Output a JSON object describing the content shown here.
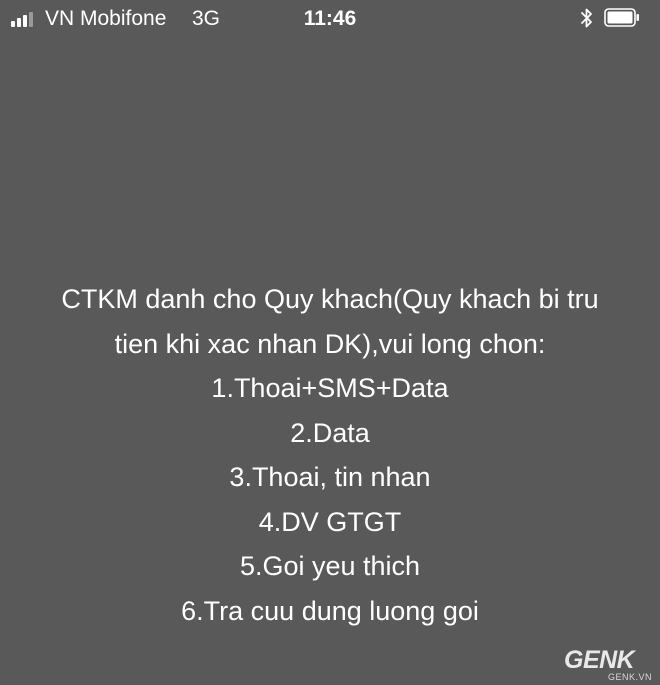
{
  "status_bar": {
    "carrier": "VN Mobifone",
    "network": "3G",
    "time": "11:46",
    "signal_bars_filled": 3,
    "signal_bars_total": 4,
    "bluetooth_icon": "bluetooth-icon",
    "battery_icon": "battery-icon"
  },
  "message": {
    "lines": [
      "CTKM danh cho Quy khach(Quy khach bi tru",
      "tien khi xac nhan DK),vui long chon:",
      "1.Thoai+SMS+Data",
      "2.Data",
      "3.Thoai, tin nhan",
      "4.DV GTGT",
      "5.Goi yeu thich",
      "6.Tra cuu dung luong goi"
    ]
  },
  "watermark": {
    "main": "GENK",
    "sub": "GENK.VN"
  },
  "colors": {
    "background": "#595959",
    "text": "#ffffff"
  }
}
